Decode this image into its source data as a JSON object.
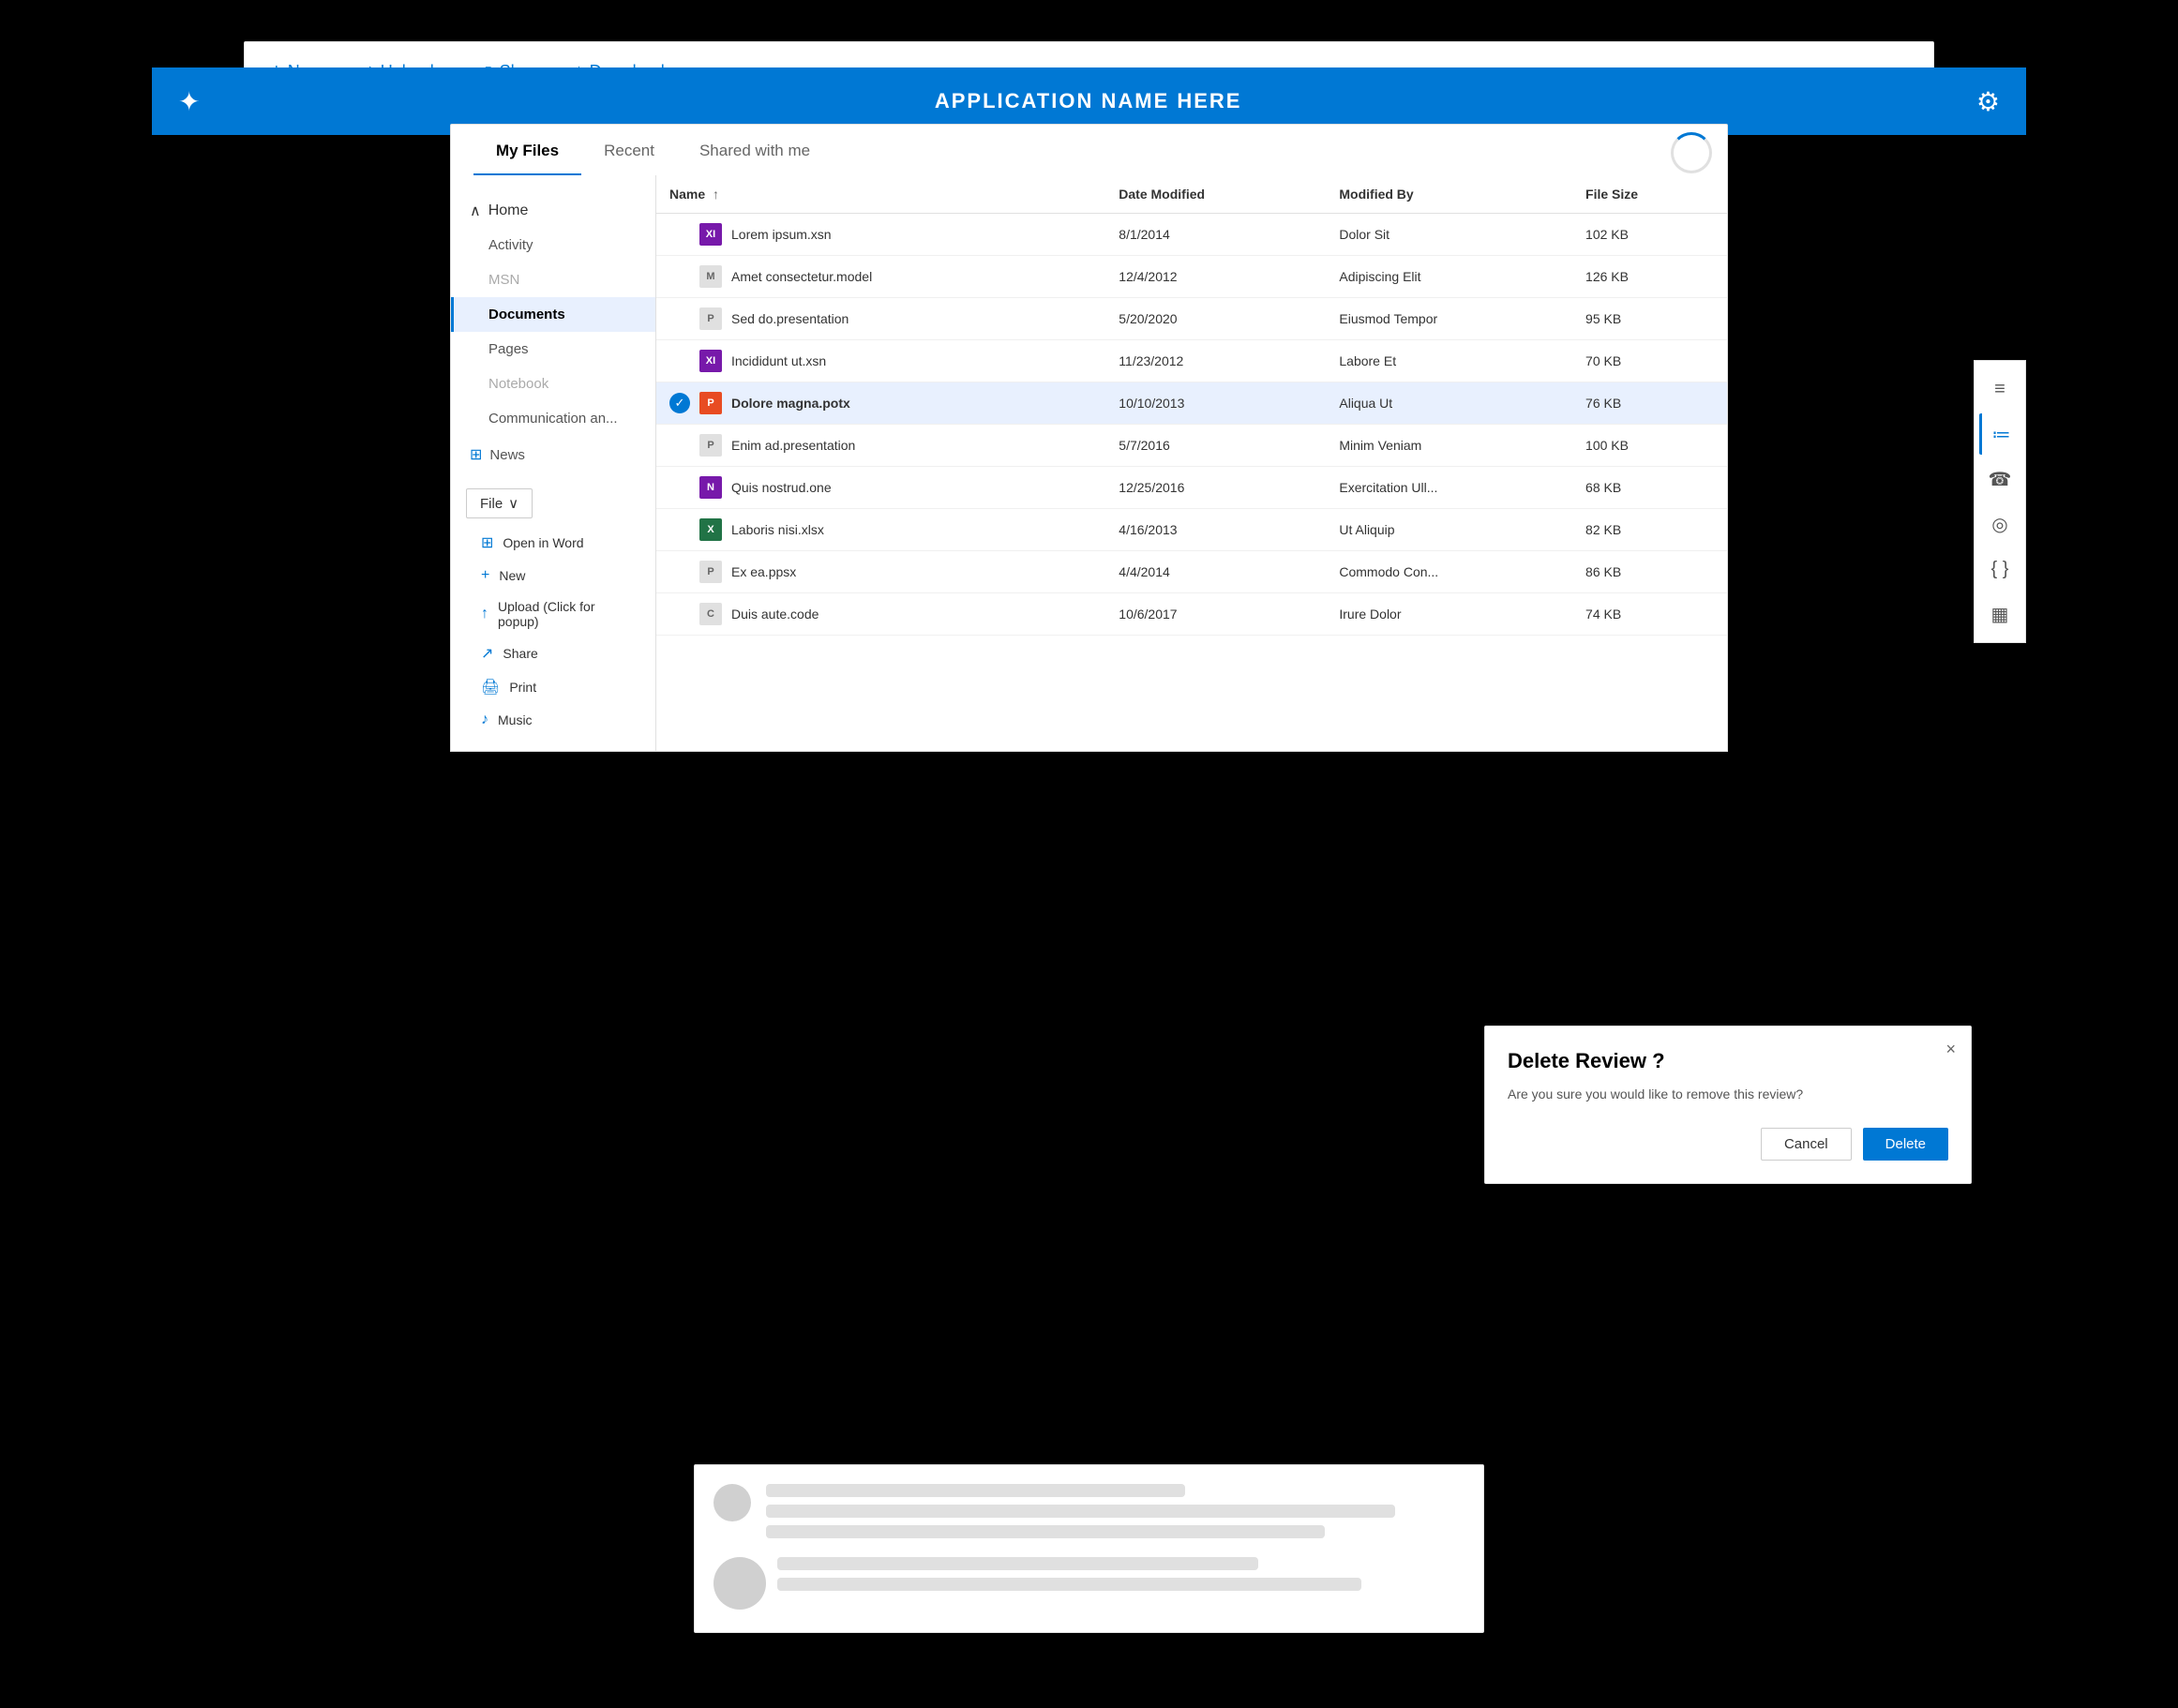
{
  "topbar": {
    "logo": "✦",
    "title": "APPLICATION NAME HERE",
    "gear_icon": "⚙"
  },
  "toolbar": {
    "new_label": "New",
    "upload_label": "Upload",
    "share_label": "Share",
    "download_label": "Download",
    "more_label": "···"
  },
  "tabs": {
    "my_files": "My Files",
    "recent": "Recent",
    "shared": "Shared with me"
  },
  "sidebar": {
    "home_label": "Home",
    "items": [
      {
        "label": "Activity",
        "active": false,
        "muted": false
      },
      {
        "label": "MSN",
        "active": false,
        "muted": true
      },
      {
        "label": "Documents",
        "active": true,
        "muted": false
      },
      {
        "label": "Pages",
        "active": false,
        "muted": false
      },
      {
        "label": "Notebook",
        "active": false,
        "muted": true
      },
      {
        "label": "Communication an...",
        "active": false,
        "muted": false
      }
    ],
    "news_label": "News"
  },
  "file_dropdown": {
    "label": "File",
    "menu_items": [
      {
        "icon": "⊞",
        "label": "Open in Word"
      },
      {
        "icon": "+",
        "label": "New"
      },
      {
        "icon": "↑",
        "label": "Upload (Click for popup)"
      },
      {
        "icon": "↗",
        "label": "Share"
      },
      {
        "icon": "🖨",
        "label": "Print"
      },
      {
        "icon": "♪",
        "label": "Music"
      }
    ]
  },
  "file_table": {
    "columns": [
      "Name",
      "Date Modified",
      "Modified By",
      "File Size"
    ],
    "rows": [
      {
        "icon": "xsn",
        "icon_label": "XI",
        "name": "Lorem ipsum.xsn",
        "date": "8/1/2014",
        "modified_by": "Dolor Sit",
        "size": "102 KB",
        "selected": false
      },
      {
        "icon": "model",
        "icon_label": "M",
        "name": "Amet consectetur.model",
        "date": "12/4/2012",
        "modified_by": "Adipiscing Elit",
        "size": "126 KB",
        "selected": false
      },
      {
        "icon": "pres",
        "icon_label": "P",
        "name": "Sed do.presentation",
        "date": "5/20/2020",
        "modified_by": "Eiusmod Tempor",
        "size": "95 KB",
        "selected": false
      },
      {
        "icon": "xsn",
        "icon_label": "XI",
        "name": "Incididunt ut.xsn",
        "date": "11/23/2012",
        "modified_by": "Labore Et",
        "size": "70 KB",
        "selected": false
      },
      {
        "icon": "potx",
        "icon_label": "P",
        "name": "Dolore magna.potx",
        "date": "10/10/2013",
        "modified_by": "Aliqua Ut",
        "size": "76 KB",
        "selected": true
      },
      {
        "icon": "pres",
        "icon_label": "P",
        "name": "Enim ad.presentation",
        "date": "5/7/2016",
        "modified_by": "Minim Veniam",
        "size": "100 KB",
        "selected": false
      },
      {
        "icon": "one",
        "icon_label": "N",
        "name": "Quis nostrud.one",
        "date": "12/25/2016",
        "modified_by": "Exercitation Ull...",
        "size": "68 KB",
        "selected": false
      },
      {
        "icon": "xlsx",
        "icon_label": "X",
        "name": "Laboris nisi.xlsx",
        "date": "4/16/2013",
        "modified_by": "Ut Aliquip",
        "size": "82 KB",
        "selected": false
      },
      {
        "icon": "ppsx",
        "icon_label": "P",
        "name": "Ex ea.ppsx",
        "date": "4/4/2014",
        "modified_by": "Commodo Con...",
        "size": "86 KB",
        "selected": false
      },
      {
        "icon": "code",
        "icon_label": "C",
        "name": "Duis aute.code",
        "date": "10/6/2017",
        "modified_by": "Irure Dolor",
        "size": "74 KB",
        "selected": false
      }
    ]
  },
  "right_panel": {
    "icons": [
      "≡",
      "≔",
      "☎",
      "◎",
      "{ }",
      "▦"
    ]
  },
  "dialog": {
    "title": "Delete Review ?",
    "body": "Are you sure you would like to remove this review?",
    "cancel_label": "Cancel",
    "delete_label": "Delete",
    "close_icon": "×"
  }
}
